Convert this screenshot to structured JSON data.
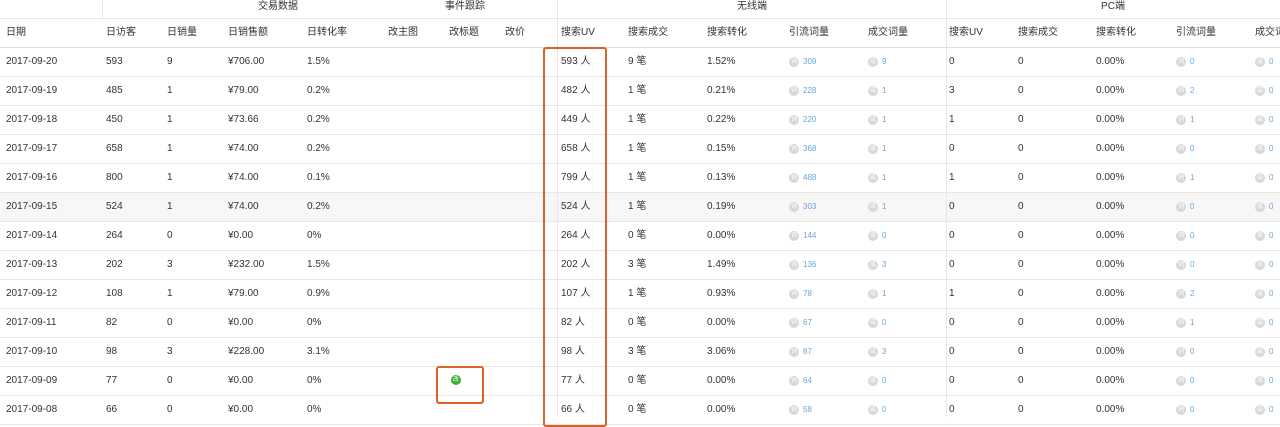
{
  "groups": {
    "trade": "交易数据",
    "event": "事件跟踪",
    "mobile": "无线端",
    "pc": "PC端"
  },
  "columns": {
    "date": "日期",
    "visitors": "日访客",
    "sales_count": "日销量",
    "sales_amount": "日销售额",
    "conversion": "日转化率",
    "edit_image": "改主图",
    "edit_title": "改标题",
    "edit_price": "改价",
    "m_search_uv": "搜索UV",
    "m_search_deals": "搜索成交",
    "m_search_conv": "搜索转化",
    "m_keywords": "引流词量",
    "m_deal_words": "成交词量",
    "pc_search_uv": "搜索UV",
    "pc_search_deals": "搜索成交",
    "pc_search_conv": "搜索转化",
    "pc_keywords": "引流词量",
    "pc_deal_words": "成交词量"
  },
  "icons": {
    "keyword_glyph": "词",
    "deal_glyph": "成",
    "edit_glyph": "改"
  },
  "colors": {
    "highlight": "#d9622b",
    "link": "#6aa4d8",
    "edit_badge": "#3cb034"
  },
  "rows": [
    {
      "date": "2017-09-20",
      "visitors": "593",
      "sales_count": "9",
      "sales_amount": "¥706.00",
      "conversion": "1.5%",
      "m_uv": "593 人",
      "m_deals": "9 笔",
      "m_conv": "1.52%",
      "m_kw": "309",
      "m_dw": "9",
      "pc_uv": "0",
      "pc_deals": "0",
      "pc_conv": "0.00%",
      "pc_kw": "0",
      "pc_dw": "0"
    },
    {
      "date": "2017-09-19",
      "visitors": "485",
      "sales_count": "1",
      "sales_amount": "¥79.00",
      "conversion": "0.2%",
      "m_uv": "482 人",
      "m_deals": "1 笔",
      "m_conv": "0.21%",
      "m_kw": "228",
      "m_dw": "1",
      "pc_uv": "3",
      "pc_deals": "0",
      "pc_conv": "0.00%",
      "pc_kw": "2",
      "pc_dw": "0"
    },
    {
      "date": "2017-09-18",
      "visitors": "450",
      "sales_count": "1",
      "sales_amount": "¥73.66",
      "conversion": "0.2%",
      "m_uv": "449 人",
      "m_deals": "1 笔",
      "m_conv": "0.22%",
      "m_kw": "220",
      "m_dw": "1",
      "pc_uv": "1",
      "pc_deals": "0",
      "pc_conv": "0.00%",
      "pc_kw": "1",
      "pc_dw": "0"
    },
    {
      "date": "2017-09-17",
      "visitors": "658",
      "sales_count": "1",
      "sales_amount": "¥74.00",
      "conversion": "0.2%",
      "m_uv": "658 人",
      "m_deals": "1 笔",
      "m_conv": "0.15%",
      "m_kw": "368",
      "m_dw": "1",
      "pc_uv": "0",
      "pc_deals": "0",
      "pc_conv": "0.00%",
      "pc_kw": "0",
      "pc_dw": "0"
    },
    {
      "date": "2017-09-16",
      "visitors": "800",
      "sales_count": "1",
      "sales_amount": "¥74.00",
      "conversion": "0.1%",
      "m_uv": "799 人",
      "m_deals": "1 笔",
      "m_conv": "0.13%",
      "m_kw": "488",
      "m_dw": "1",
      "pc_uv": "1",
      "pc_deals": "0",
      "pc_conv": "0.00%",
      "pc_kw": "1",
      "pc_dw": "0"
    },
    {
      "date": "2017-09-15",
      "visitors": "524",
      "sales_count": "1",
      "sales_amount": "¥74.00",
      "conversion": "0.2%",
      "m_uv": "524 人",
      "m_deals": "1 笔",
      "m_conv": "0.19%",
      "m_kw": "303",
      "m_dw": "1",
      "pc_uv": "0",
      "pc_deals": "0",
      "pc_conv": "0.00%",
      "pc_kw": "0",
      "pc_dw": "0"
    },
    {
      "date": "2017-09-14",
      "visitors": "264",
      "sales_count": "0",
      "sales_amount": "¥0.00",
      "conversion": "0%",
      "m_uv": "264 人",
      "m_deals": "0 笔",
      "m_conv": "0.00%",
      "m_kw": "144",
      "m_dw": "0",
      "pc_uv": "0",
      "pc_deals": "0",
      "pc_conv": "0.00%",
      "pc_kw": "0",
      "pc_dw": "0"
    },
    {
      "date": "2017-09-13",
      "visitors": "202",
      "sales_count": "3",
      "sales_amount": "¥232.00",
      "conversion": "1.5%",
      "m_uv": "202 人",
      "m_deals": "3 笔",
      "m_conv": "1.49%",
      "m_kw": "136",
      "m_dw": "3",
      "pc_uv": "0",
      "pc_deals": "0",
      "pc_conv": "0.00%",
      "pc_kw": "0",
      "pc_dw": "0"
    },
    {
      "date": "2017-09-12",
      "visitors": "108",
      "sales_count": "1",
      "sales_amount": "¥79.00",
      "conversion": "0.9%",
      "m_uv": "107 人",
      "m_deals": "1 笔",
      "m_conv": "0.93%",
      "m_kw": "78",
      "m_dw": "1",
      "pc_uv": "1",
      "pc_deals": "0",
      "pc_conv": "0.00%",
      "pc_kw": "2",
      "pc_dw": "0"
    },
    {
      "date": "2017-09-11",
      "visitors": "82",
      "sales_count": "0",
      "sales_amount": "¥0.00",
      "conversion": "0%",
      "m_uv": "82 人",
      "m_deals": "0 笔",
      "m_conv": "0.00%",
      "m_kw": "67",
      "m_dw": "0",
      "pc_uv": "0",
      "pc_deals": "0",
      "pc_conv": "0.00%",
      "pc_kw": "1",
      "pc_dw": "0"
    },
    {
      "date": "2017-09-10",
      "visitors": "98",
      "sales_count": "3",
      "sales_amount": "¥228.00",
      "conversion": "3.1%",
      "m_uv": "98 人",
      "m_deals": "3 笔",
      "m_conv": "3.06%",
      "m_kw": "87",
      "m_dw": "3",
      "pc_uv": "0",
      "pc_deals": "0",
      "pc_conv": "0.00%",
      "pc_kw": "0",
      "pc_dw": "0"
    },
    {
      "date": "2017-09-09",
      "visitors": "77",
      "sales_count": "0",
      "sales_amount": "¥0.00",
      "conversion": "0%",
      "m_uv": "77 人",
      "m_deals": "0 笔",
      "m_conv": "0.00%",
      "m_kw": "64",
      "m_dw": "0",
      "pc_uv": "0",
      "pc_deals": "0",
      "pc_conv": "0.00%",
      "pc_kw": "0",
      "pc_dw": "0",
      "edit_title": true
    },
    {
      "date": "2017-09-08",
      "visitors": "66",
      "sales_count": "0",
      "sales_amount": "¥0.00",
      "conversion": "0%",
      "m_uv": "66 人",
      "m_deals": "0 笔",
      "m_conv": "0.00%",
      "m_kw": "58",
      "m_dw": "0",
      "pc_uv": "0",
      "pc_deals": "0",
      "pc_conv": "0.00%",
      "pc_kw": "0",
      "pc_dw": "0"
    }
  ]
}
